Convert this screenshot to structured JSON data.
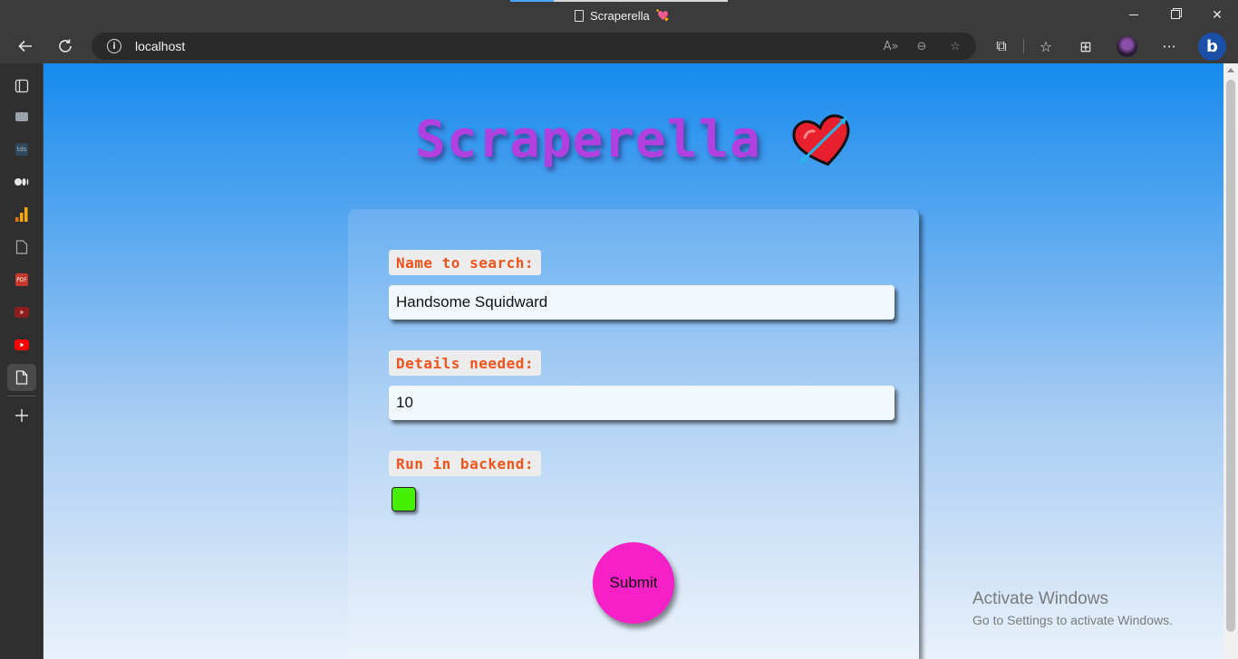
{
  "browser": {
    "tab_title": "Scraperella",
    "tab_emoji": "💘",
    "url": "localhost",
    "window_controls": {
      "minimize": "minimize-icon",
      "maximize": "restore-icon",
      "close": "✕"
    }
  },
  "toolbar_icons": [
    "back-icon",
    "refresh-icon",
    "read-aloud-icon",
    "zoom-out-icon",
    "add-favorite-icon",
    "extensions-icon",
    "favorites-icon",
    "collections-icon",
    "profile-avatar",
    "more-icon",
    "bing-icon"
  ],
  "sidebar_icons": [
    "tab-actions-icon",
    "reading-icon",
    "tds-icon",
    "medium-icon",
    "analytics-icon",
    "document-icon",
    "pdf-icon",
    "youtube-dark-icon",
    "youtube-icon",
    "active-page-icon",
    "add-icon"
  ],
  "page": {
    "title": "Scraperella",
    "title_emoji": "💘",
    "form": {
      "name_label": "Name to search:",
      "name_value": "Handsome Squidward",
      "details_label": "Details needed:",
      "details_value": "10",
      "backend_label": "Run in backend:",
      "backend_checked": false,
      "submit_label": "Submit"
    }
  },
  "watermark": {
    "line1": "Activate Windows",
    "line2": "Go to Settings to activate Windows."
  },
  "colors": {
    "title": "#b23fe0",
    "label_text": "#f0541b",
    "checkbox": "#47f000",
    "submit": "#f621c6",
    "page_gradient_top": "#168bee",
    "page_gradient_bottom": "#e9f1fb"
  }
}
